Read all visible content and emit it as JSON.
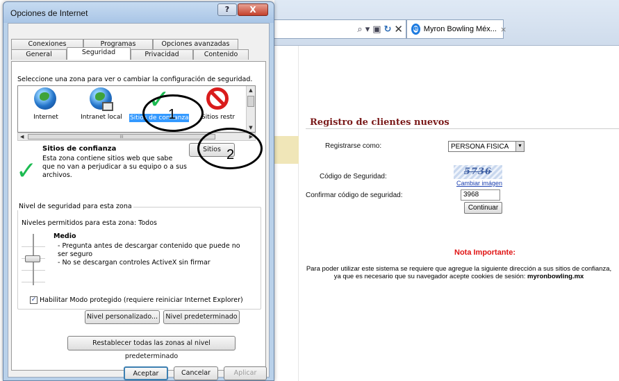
{
  "browser": {
    "tab_title": "Myron Bowling Méx...",
    "tab_close": "×",
    "address_icons": {
      "search": "⌕",
      "dropdown": "▾",
      "compat": "▣",
      "refresh": "↻",
      "stop": "✕"
    }
  },
  "dialog": {
    "title": "Opciones de Internet",
    "help_label": "?",
    "close_label": "X",
    "tabs_row1": [
      "Conexiones",
      "Programas",
      "Opciones avanzadas"
    ],
    "tabs_row2": [
      "General",
      "Seguridad",
      "Privacidad",
      "Contenido"
    ],
    "active_tab": "Seguridad",
    "zone_prompt": "Seleccione una zona para ver o cambiar la configuración de seguridad.",
    "zones": [
      {
        "label": "Internet",
        "icon": "globe-icon"
      },
      {
        "label": "Intranet local",
        "icon": "intranet-icon"
      },
      {
        "label": "Sitios de confianza",
        "icon": "check-icon"
      },
      {
        "label": "Sitios restr",
        "icon": "restricted-icon"
      }
    ],
    "hscroll_thumb": "III",
    "selected_zone": {
      "name": "Sitios de confianza",
      "description": "Esta zona contiene sitios web que sabe que no van a perjudicar a su equipo o a sus archivos."
    },
    "sitios_button": "Sitios",
    "security_group": {
      "legend": "Nivel de seguridad para esta zona",
      "allowed": "Niveles permitidos para esta zona: Todos",
      "level_name": "Medio",
      "level_lines": [
        "- Pregunta antes de descargar contenido que puede no ser seguro",
        "- No se descargan controles ActiveX sin firmar"
      ],
      "protected_mode_label": "Habilitar Modo protegido (requiere reiniciar Internet Explorer)",
      "protected_mode_checked": "✓",
      "custom_level_button": "Nivel personalizado...",
      "default_level_button": "Nivel predeterminado"
    },
    "reset_all_button": "Restablecer todas las zonas al nivel predeterminado",
    "footer": {
      "ok": "Aceptar",
      "cancel": "Cancelar",
      "apply": "Aplicar"
    }
  },
  "annotations": {
    "one": "1",
    "two": "2"
  },
  "webpage": {
    "title": "Registro de clientes nuevos",
    "register_as_label": "Registrarse como:",
    "register_as_value": "PERSONA FISICA",
    "security_code_label": "Código de Seguridad:",
    "captcha_text": "5736",
    "change_image_link": "Cambiar imágen",
    "confirm_code_label": "Confirmar código de seguridad:",
    "confirm_code_value": "3968",
    "continue_button": "Continuar",
    "note_title": "Nota Importante:",
    "note_line1": "Para poder utilizar este sistema se requiere que agregue la siguiente dirección a sus sitios de confianza,",
    "note_line2_prefix": "ya que es necesario que su navegador acepte cookies de sesión: ",
    "note_domain": "myronbowling.mx"
  },
  "colors": {
    "accent_blue": "#3399ff",
    "note_red": "#e01414",
    "title_maroon": "#7a1a1a",
    "check_green": "#1dbb52"
  }
}
